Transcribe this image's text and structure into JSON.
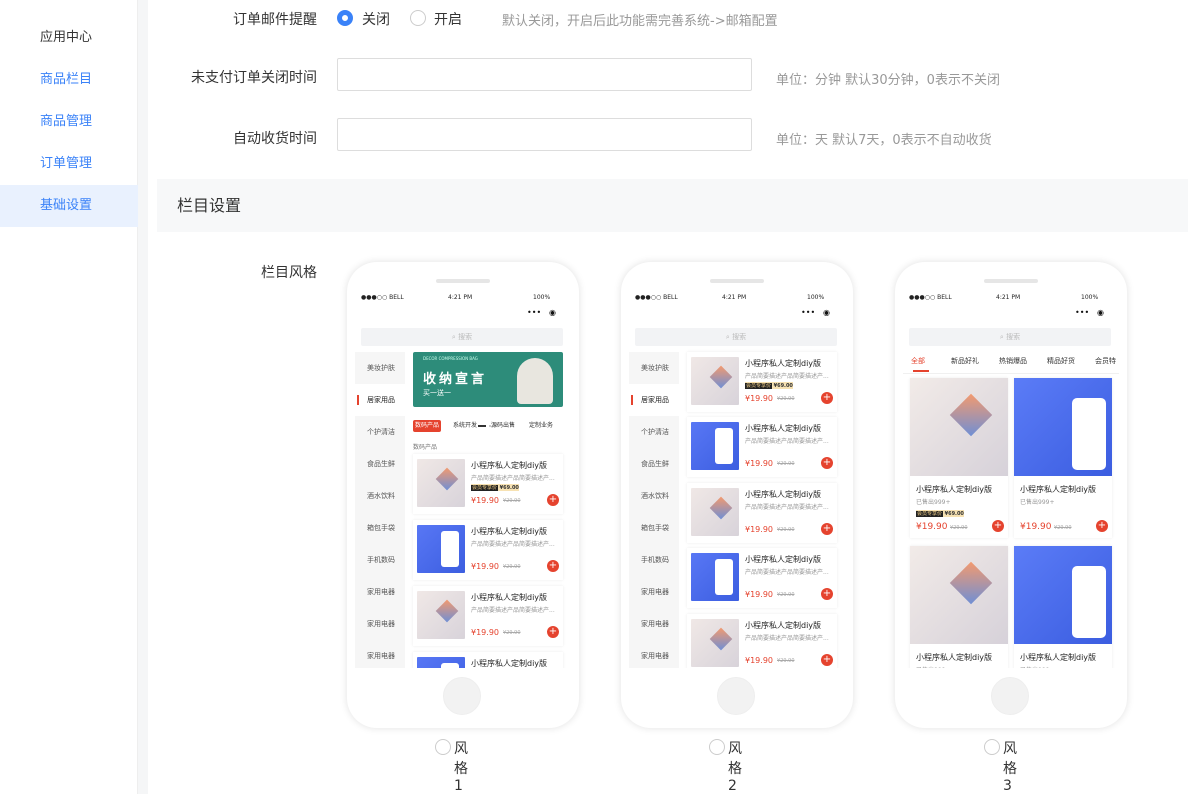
{
  "sidebar": {
    "items": [
      {
        "label": "应用中心"
      },
      {
        "label": "商品栏目"
      },
      {
        "label": "商品管理"
      },
      {
        "label": "订单管理"
      },
      {
        "label": "基础设置"
      }
    ]
  },
  "form": {
    "email_notice": {
      "label": "订单邮件提醒",
      "option_off": "关闭",
      "option_on": "开启",
      "selected": "关闭",
      "hint": "默认关闭，开启后此功能需完善系统->邮箱配置"
    },
    "unpaid_close": {
      "label": "未支付订单关闭时间",
      "value": "",
      "hint": "单位：分钟 默认30分钟，0表示不关闭"
    },
    "auto_receive": {
      "label": "自动收货时间",
      "value": "",
      "hint": "单位：天 默认7天，0表示不自动收货"
    }
  },
  "section": {
    "title": "栏目设置",
    "style_label": "栏目风格",
    "styles": [
      "风格1",
      "风格2",
      "风格3"
    ]
  },
  "phone": {
    "carrier": "●●●○○ BELL",
    "time": "4:21 PM",
    "battery": "100%",
    "search_placeholder": "搜索",
    "categories": [
      "美妆护肤",
      "居家用品",
      "个护清洁",
      "食品生鲜",
      "酒水饮料",
      "箱包手袋",
      "手机数码",
      "家用电器",
      "家用电器",
      "家用电器"
    ],
    "selected_category": "居家用品",
    "banner": {
      "small": "DECOR COMPRESSION BAG",
      "title": "收纳宣言",
      "subtitle": "买一送一"
    },
    "subtabs": [
      "数码产品",
      "系统开发",
      "源码出售",
      "定制业务"
    ],
    "subhead": "数码产品",
    "product": {
      "title": "小程序私人定制diy版",
      "desc": "产品简要描述产品简要描述产...",
      "vip_tag": "会员专享价",
      "vip_price": "¥69.00",
      "price": "¥19.90",
      "old_price": "¥29.90"
    },
    "style3_tabs": [
      "全部",
      "新品好礼",
      "热销爆品",
      "精品好货",
      "会员特"
    ],
    "sold": "已售出999+"
  },
  "colors": {
    "accent": "#3a82f8",
    "price_red": "#e5432e",
    "banner_green": "#2d8c7a"
  }
}
